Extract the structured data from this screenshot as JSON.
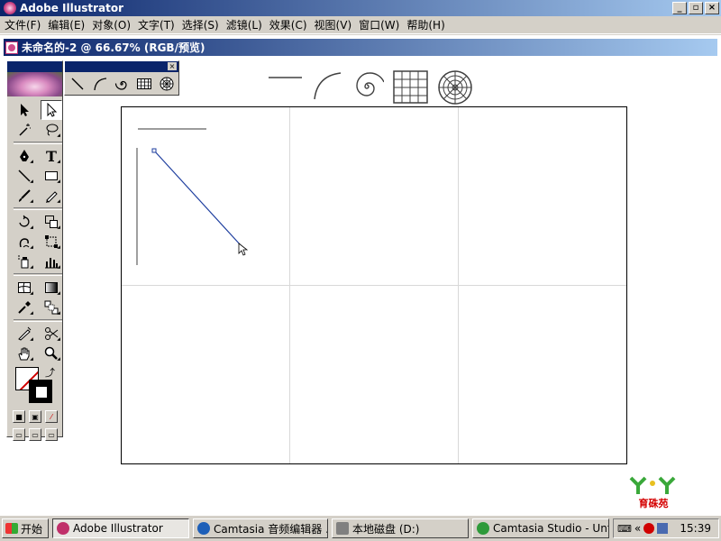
{
  "window": {
    "title": "Adobe Illustrator",
    "controls": [
      "_",
      "▫",
      "×"
    ]
  },
  "menu": [
    "文件(F)",
    "编辑(E)",
    "对象(O)",
    "文字(T)",
    "选择(S)",
    "滤镜(L)",
    "效果(C)",
    "视图(V)",
    "窗口(W)",
    "帮助(H)"
  ],
  "document": {
    "title": "未命名的-2 @ 66.67% (RGB/预览)"
  },
  "toolbox": {
    "tools": [
      "selection-tool",
      "direct-selection-tool",
      "magic-wand-tool",
      "lasso-tool",
      "pen-tool",
      "type-tool",
      "line-segment-tool",
      "rectangle-tool",
      "paintbrush-tool",
      "pencil-tool",
      "rotate-tool",
      "scale-tool",
      "warp-tool",
      "free-transform-tool",
      "symbol-sprayer-tool",
      "column-graph-tool",
      "mesh-tool",
      "gradient-tool",
      "eyedropper-tool",
      "blend-tool",
      "slice-tool",
      "scissors-tool",
      "hand-tool",
      "zoom-tool"
    ],
    "type_glyph": "T"
  },
  "palette": {
    "close": "×",
    "tools": [
      "line-segment-tool",
      "arc-tool",
      "spiral-tool",
      "rectangular-grid-tool",
      "polar-grid-tool"
    ]
  },
  "logo": {
    "text": "育硃苑"
  },
  "taskbar": {
    "start": "开始",
    "tasks": [
      {
        "label": "Adobe Illustrator",
        "icon": "illustrator-icon",
        "color": "#c0306a"
      },
      {
        "label": "Camtasia 音频编辑器 ...",
        "icon": "camtasia-audio-icon",
        "color": "#1d5fb8"
      },
      {
        "label": "本地磁盘 (D:)",
        "icon": "drive-icon",
        "color": "#808080"
      },
      {
        "label": "Camtasia Studio - Untitl...",
        "icon": "camtasia-studio-icon",
        "color": "#2e9a3a"
      }
    ],
    "tray_chevron": "«",
    "clock": "15:39"
  }
}
